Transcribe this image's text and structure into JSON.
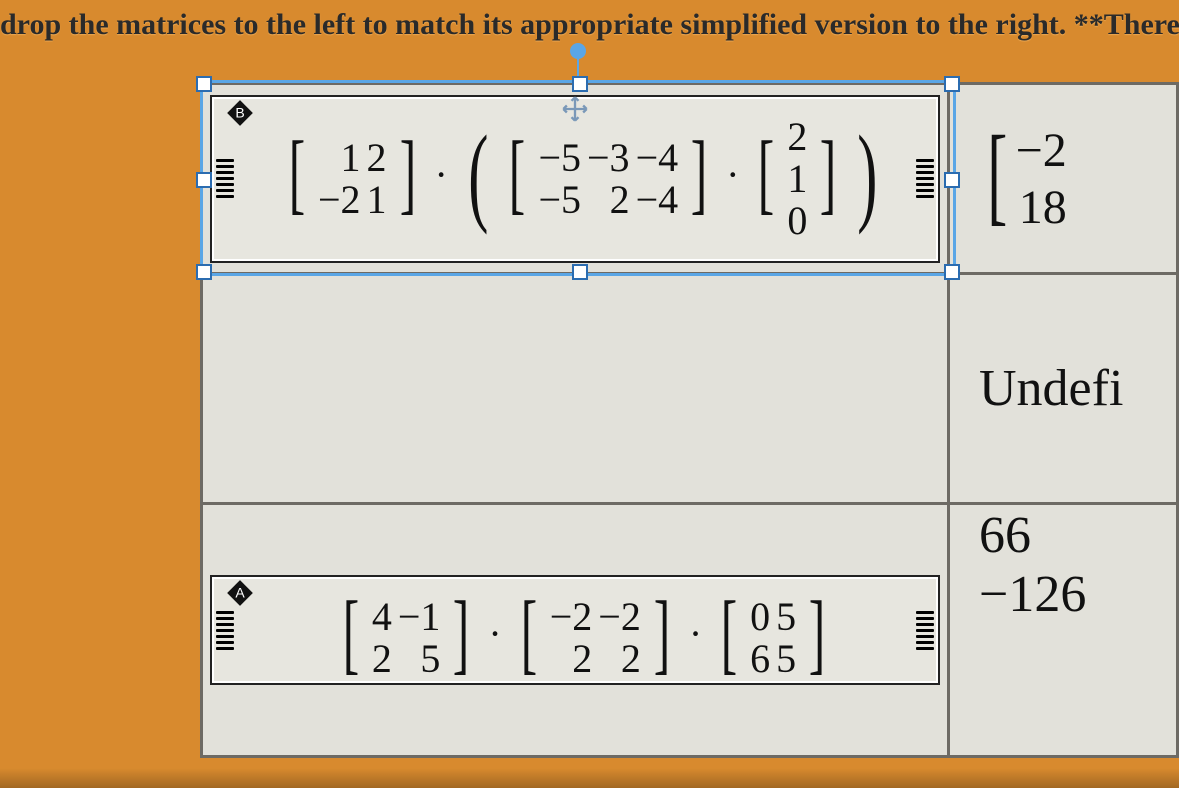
{
  "instruction": "drop the matrices to the left to match its appropriate simplified version to the right. **There",
  "tiles": {
    "b": {
      "badge": "B",
      "m1": {
        "r1c1": "1",
        "r1c2": "2",
        "r2c1": "−2",
        "r2c2": "1"
      },
      "m2": {
        "r1c1": "−5",
        "r1c2": "−3",
        "r1c3": "−4",
        "r2c1": "−5",
        "r2c2": "2",
        "r2c3": "−4"
      },
      "v": {
        "r1": "2",
        "r2": "1",
        "r3": "0"
      },
      "op1": "·",
      "op2": "·"
    },
    "a": {
      "badge": "A",
      "m1": {
        "r1c1": "4",
        "r1c2": "−1",
        "r2c1": "2",
        "r2c2": "5"
      },
      "m2": {
        "r1c1": "−2",
        "r1c2": "−2",
        "r2c1": "2",
        "r2c2": "2"
      },
      "m3": {
        "r1c1": "0",
        "r1c2": "5",
        "r2c1": "6",
        "r2c2": "5"
      },
      "op1": "·",
      "op2": "·"
    }
  },
  "answers": {
    "r1": {
      "a": "−2",
      "b": "18"
    },
    "r2": "Undefi",
    "r3": {
      "a": "66",
      "b": "−126"
    }
  }
}
